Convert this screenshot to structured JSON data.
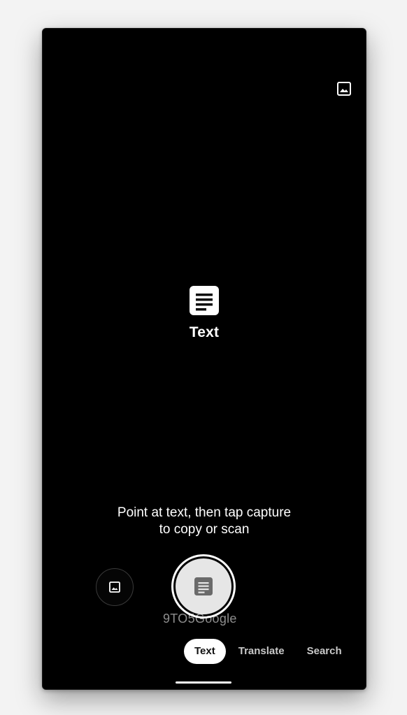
{
  "app": {
    "mode_label": "Text",
    "hint_line1": "Point at text, then tap capture",
    "hint_line2": "to copy or scan",
    "watermark": "9TO5Google"
  },
  "tabs": [
    {
      "label": "Text",
      "active": true
    },
    {
      "label": "Translate",
      "active": false
    },
    {
      "label": "Search",
      "active": false
    }
  ],
  "icons": {
    "gallery_top": "image-icon",
    "mode": "text-document-icon",
    "gallery_button": "image-icon",
    "shutter": "text-document-icon"
  },
  "colors": {
    "background": "#000000",
    "text": "#ffffff",
    "shutter_fill": "#e6e6e6",
    "tab_active_bg": "#ffffff",
    "tab_inactive_text": "#c9c9c9"
  }
}
